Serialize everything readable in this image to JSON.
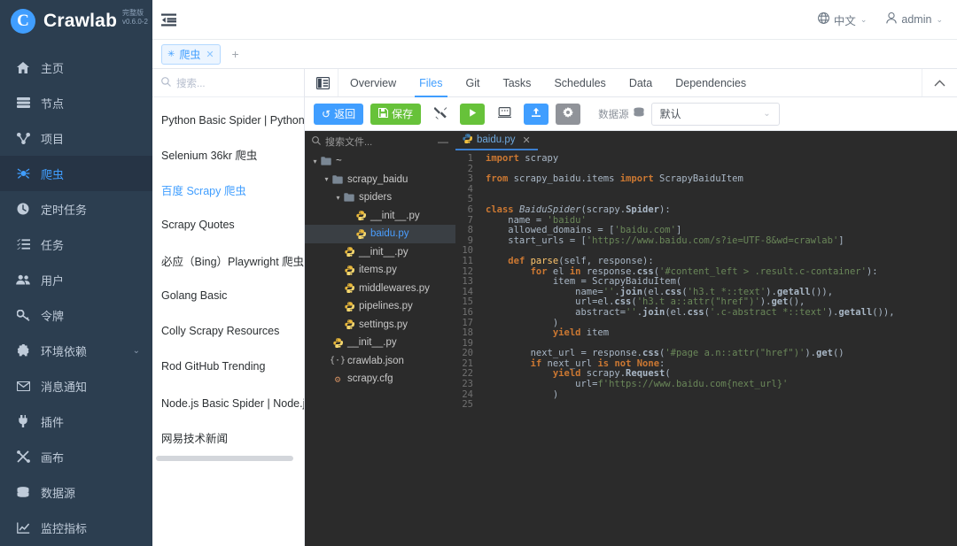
{
  "brand": {
    "name": "Crawlab",
    "edition": "完整版",
    "version": "v0.6.0-2",
    "logo_letter": "C"
  },
  "sidebar": {
    "items": [
      {
        "label": "主页",
        "icon": "home-icon",
        "active": false
      },
      {
        "label": "节点",
        "icon": "nodes-icon",
        "active": false
      },
      {
        "label": "项目",
        "icon": "project-icon",
        "active": false
      },
      {
        "label": "爬虫",
        "icon": "spider-icon",
        "active": true
      },
      {
        "label": "定时任务",
        "icon": "clock-icon",
        "active": false
      },
      {
        "label": "任务",
        "icon": "tasks-icon",
        "active": false
      },
      {
        "label": "用户",
        "icon": "users-icon",
        "active": false
      },
      {
        "label": "令牌",
        "icon": "key-icon",
        "active": false
      },
      {
        "label": "环境依赖",
        "icon": "puzzle-icon",
        "active": false,
        "caret": "⌄"
      },
      {
        "label": "消息通知",
        "icon": "envelope-icon",
        "active": false
      },
      {
        "label": "插件",
        "icon": "plug-icon",
        "active": false
      },
      {
        "label": "画布",
        "icon": "canvas-icon",
        "active": false
      },
      {
        "label": "数据源",
        "icon": "database-icon",
        "active": false
      },
      {
        "label": "监控指标",
        "icon": "chart-line-icon",
        "active": false
      }
    ]
  },
  "topbar": {
    "menu_toggle_icon": "menu-fold-icon",
    "language": {
      "label": "中文",
      "icon": "globe-icon",
      "caret": "⌄"
    },
    "user": {
      "label": "admin",
      "icon": "user-icon",
      "caret": "⌄"
    }
  },
  "view_tabs": {
    "tabs": [
      {
        "label": "爬虫",
        "icon": "spider-icon",
        "close": "✕",
        "active": true
      }
    ],
    "add_label": "+"
  },
  "spider_list": {
    "search_placeholder": "搜索...",
    "search_icon": "search-icon",
    "items": [
      {
        "label": "Python Basic Spider | Python 基础爬虫",
        "active": false
      },
      {
        "label": "Selenium 36kr 爬虫",
        "active": false
      },
      {
        "label": "百度 Scrapy 爬虫",
        "active": true
      },
      {
        "label": "Scrapy Quotes",
        "active": false
      },
      {
        "label": "必应（Bing）Playwright 爬虫",
        "active": false
      },
      {
        "label": "Golang Basic",
        "active": false
      },
      {
        "label": "Colly Scrapy Resources",
        "active": false
      },
      {
        "label": "Rod GitHub Trending",
        "active": false
      },
      {
        "label": "Node.js Basic Spider | Node.js 基础爬虫",
        "active": false
      },
      {
        "label": "网易技术新闻",
        "active": false
      }
    ]
  },
  "nav_tabs": {
    "collapse_icon": "panel-collapse-icon",
    "chevron_icon": "chevron-up-icon",
    "tabs": [
      {
        "label": "Overview",
        "active": false
      },
      {
        "label": "Files",
        "active": true
      },
      {
        "label": "Git",
        "active": false
      },
      {
        "label": "Tasks",
        "active": false
      },
      {
        "label": "Schedules",
        "active": false
      },
      {
        "label": "Data",
        "active": false
      },
      {
        "label": "Dependencies",
        "active": false
      }
    ]
  },
  "toolbar": {
    "back_label": "返回",
    "back_icon": "undo-icon",
    "save_label": "保存",
    "save_icon": "save-icon",
    "wrench_icon": "tools-icon",
    "run_icon": "play-icon",
    "terminal_icon": "terminal-icon",
    "upload_icon": "upload-icon",
    "settings_icon": "gear-icon",
    "datasource_label": "数据源",
    "datasource_icon": "database-icon",
    "datasource_value": "默认",
    "datasource_caret": "⌄"
  },
  "file_tree": {
    "search_placeholder": "搜索文件...",
    "search_icon": "search-icon",
    "minimize_icon": "minimize-icon",
    "nodes": [
      {
        "depth": 0,
        "arrow": "▾",
        "icon": "folder-icon",
        "label": "~",
        "selected": false
      },
      {
        "depth": 1,
        "arrow": "▾",
        "icon": "folder-icon",
        "label": "scrapy_baidu",
        "selected": false
      },
      {
        "depth": 2,
        "arrow": "▾",
        "icon": "folder-icon",
        "label": "spiders",
        "selected": false
      },
      {
        "depth": 3,
        "arrow": "",
        "icon": "python-icon",
        "label": "__init__.py",
        "selected": false
      },
      {
        "depth": 3,
        "arrow": "",
        "icon": "python-icon",
        "label": "baidu.py",
        "selected": true
      },
      {
        "depth": 2,
        "arrow": "",
        "icon": "python-icon",
        "label": "__init__.py",
        "selected": false
      },
      {
        "depth": 2,
        "arrow": "",
        "icon": "python-icon",
        "label": "items.py",
        "selected": false
      },
      {
        "depth": 2,
        "arrow": "",
        "icon": "python-icon",
        "label": "middlewares.py",
        "selected": false
      },
      {
        "depth": 2,
        "arrow": "",
        "icon": "python-icon",
        "label": "pipelines.py",
        "selected": false
      },
      {
        "depth": 2,
        "arrow": "",
        "icon": "python-icon",
        "label": "settings.py",
        "selected": false
      },
      {
        "depth": 1,
        "arrow": "",
        "icon": "python-icon",
        "label": "__init__.py",
        "selected": false
      },
      {
        "depth": 1,
        "arrow": "",
        "icon": "json-icon",
        "label": "crawlab.json",
        "selected": false
      },
      {
        "depth": 1,
        "arrow": "",
        "icon": "cfg-icon",
        "label": "scrapy.cfg",
        "selected": false
      }
    ]
  },
  "editor": {
    "tabs": [
      {
        "label": "baidu.py",
        "icon": "python-icon",
        "close": "✕",
        "active": true
      }
    ],
    "line_count": 25,
    "code_lines": [
      "import scrapy",
      "",
      "from scrapy_baidu.items import ScrapyBaiduItem",
      "",
      "",
      "class BaiduSpider(scrapy.Spider):",
      "    name = 'baidu'",
      "    allowed_domains = ['baidu.com']",
      "    start_urls = ['https://www.baidu.com/s?ie=UTF-8&wd=crawlab']",
      "",
      "    def parse(self, response):",
      "        for el in response.css('#content_left > .result.c-container'):",
      "            item = ScrapyBaiduItem(",
      "                name=''.join(el.css('h3.t *::text').getall()),",
      "                url=el.css('h3.t a::attr(\"href\")').get(),",
      "                abstract=''.join(el.css('.c-abstract *::text').getall()),",
      "            )",
      "            yield item",
      "",
      "        next_url = response.css('#page a.n::attr(\"href\")').get()",
      "        if next_url is not None:",
      "            yield scrapy.Request(",
      "                url=f'https://www.baidu.com{next_url}'",
      "            )",
      ""
    ]
  },
  "colors": {
    "sidebar_bg": "#2c3e50",
    "sidebar_active_bg": "#263445",
    "accent": "#409eff",
    "success": "#67c23a",
    "grey": "#909399",
    "editor_bg": "#2b2b2b"
  }
}
